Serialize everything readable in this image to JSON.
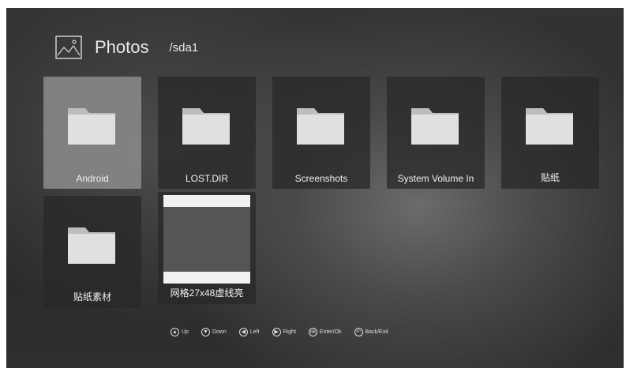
{
  "header": {
    "title": "Photos",
    "path": "/sda1",
    "icon": "photos-icon"
  },
  "items": [
    {
      "label": "Android",
      "type": "folder",
      "selected": true
    },
    {
      "label": "LOST.DIR",
      "type": "folder",
      "selected": false
    },
    {
      "label": "Screenshots",
      "type": "folder",
      "selected": false
    },
    {
      "label": "System Volume In",
      "type": "folder",
      "selected": false
    },
    {
      "label": "贴纸",
      "type": "folder",
      "selected": false
    },
    {
      "label": "贴纸素材",
      "type": "folder",
      "selected": false
    },
    {
      "label": "网格27x48虚线亮",
      "type": "image",
      "selected": false
    }
  ],
  "hints": [
    {
      "glyph": "▲",
      "label": "Up",
      "icon": "up-icon"
    },
    {
      "glyph": "▼",
      "label": "Down",
      "icon": "down-icon"
    },
    {
      "glyph": "◀",
      "label": "Left",
      "icon": "left-icon"
    },
    {
      "glyph": "▶",
      "label": "Right",
      "icon": "right-icon"
    },
    {
      "glyph": "ok",
      "label": "Enter/Ok",
      "icon": "enter-icon"
    },
    {
      "glyph": "↶",
      "label": "Back/Exit",
      "icon": "back-icon"
    }
  ],
  "colors": {
    "folder": "#d6d6d6",
    "selected_tile": "#8c8c8c",
    "background": "#2d2d2d"
  }
}
